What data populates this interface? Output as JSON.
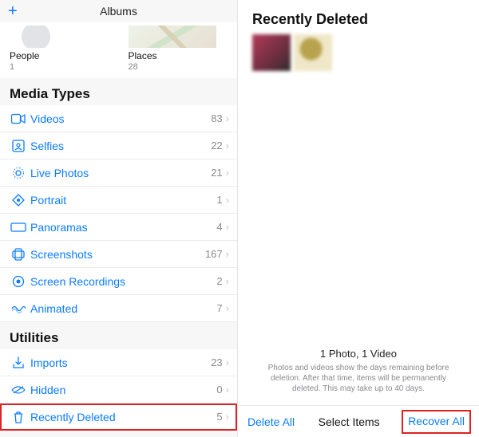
{
  "left": {
    "nav": {
      "title": "Albums"
    },
    "tiles": {
      "people": {
        "label": "People",
        "count": "1"
      },
      "places": {
        "label": "Places",
        "count": "28"
      }
    },
    "media_types_header": "Media Types",
    "media_types": [
      {
        "icon": "video-icon",
        "label": "Videos",
        "count": "83"
      },
      {
        "icon": "selfies-icon",
        "label": "Selfies",
        "count": "22"
      },
      {
        "icon": "livephotos-icon",
        "label": "Live Photos",
        "count": "21"
      },
      {
        "icon": "portrait-icon",
        "label": "Portrait",
        "count": "1"
      },
      {
        "icon": "panoramas-icon",
        "label": "Panoramas",
        "count": "4"
      },
      {
        "icon": "screenshots-icon",
        "label": "Screenshots",
        "count": "167"
      },
      {
        "icon": "screenrec-icon",
        "label": "Screen Recordings",
        "count": "2"
      },
      {
        "icon": "animated-icon",
        "label": "Animated",
        "count": "7"
      }
    ],
    "utilities_header": "Utilities",
    "utilities": [
      {
        "icon": "imports-icon",
        "label": "Imports",
        "count": "23"
      },
      {
        "icon": "hidden-icon",
        "label": "Hidden",
        "count": "0"
      },
      {
        "icon": "trash-icon",
        "label": "Recently Deleted",
        "count": "5",
        "highlight": true
      }
    ]
  },
  "right": {
    "title": "Recently Deleted",
    "summary": "1 Photo, 1 Video",
    "description": "Photos and videos show the days remaining before deletion. After that time, items will be permanently deleted. This may take up to 40 days.",
    "toolbar": {
      "delete_all": "Delete All",
      "select_items": "Select Items",
      "recover_all": "Recover All"
    }
  },
  "chevron": "›"
}
